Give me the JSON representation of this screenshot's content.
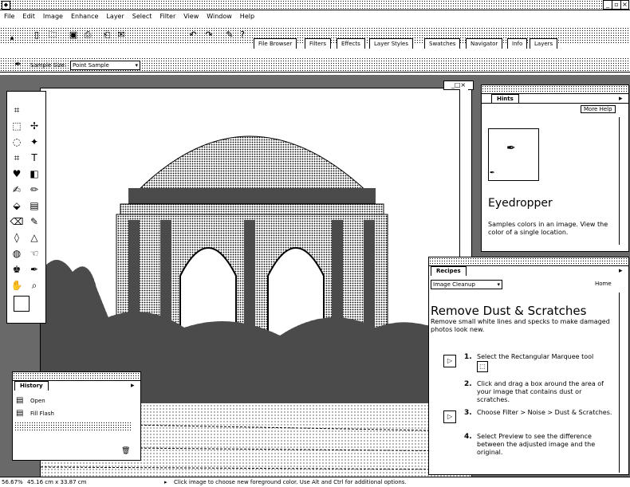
{
  "menu": [
    "File",
    "Edit",
    "Image",
    "Enhance",
    "Layer",
    "Select",
    "Filter",
    "View",
    "Window",
    "Help"
  ],
  "palette_tabs": [
    "File Browser",
    "Filters",
    "Effects",
    "Layer Styles",
    "Swatches",
    "Navigator",
    "Info",
    "Layers"
  ],
  "options": {
    "sample_label": "Sample Size:",
    "sample_value": "Point Sample"
  },
  "hints": {
    "tab": "Hints",
    "more_help": "More Help",
    "title": "Eyedropper",
    "description": "Samples colors in an image. View the color of a single location."
  },
  "recipes": {
    "tab": "Recipes",
    "category": "Image Cleanup",
    "home": "Home",
    "title": "Remove Dust & Scratches",
    "subtitle": "Remove small white lines and specks to make damaged photos look new.",
    "steps": [
      {
        "num": "1.",
        "text": "Select the Rectangular Marquee tool"
      },
      {
        "num": "2.",
        "text": "Click and drag a box around the area of your image that contains dust or scratches."
      },
      {
        "num": "3.",
        "text": "Choose Filter > Noise > Dust & Scratches."
      },
      {
        "num": "4.",
        "text": "Select Preview to see the difference between the adjusted image and the original."
      }
    ]
  },
  "history": {
    "tab": "History",
    "items": [
      "Open",
      "Fill Flash"
    ]
  },
  "status": {
    "zoom": "56.67%",
    "size": "45.16 cm x 33.87 cm",
    "hint": "Click image to choose new foreground color. Use Alt and Ctrl for additional options."
  }
}
